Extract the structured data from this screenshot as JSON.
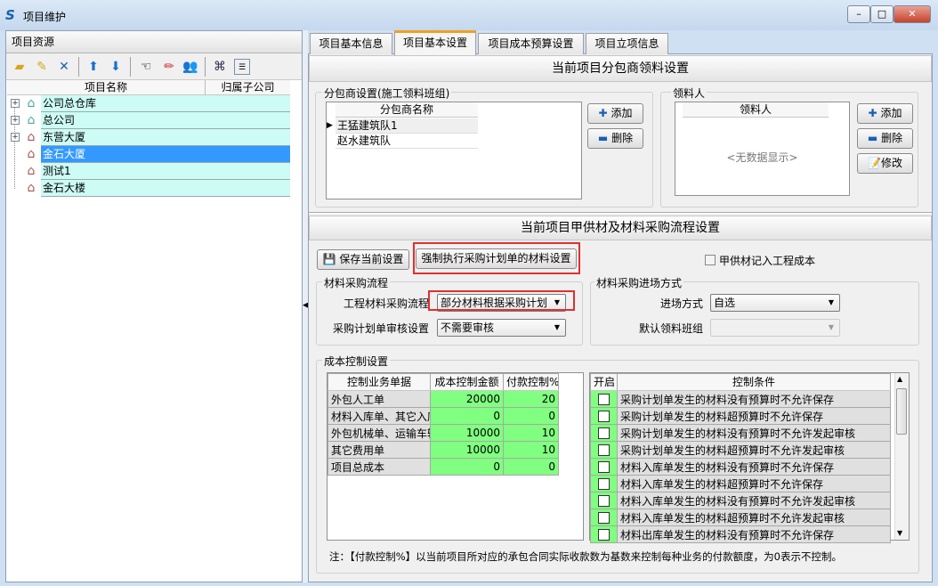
{
  "window": {
    "title": "项目维护",
    "controls": [
      "minimize",
      "maximize",
      "close"
    ]
  },
  "left": {
    "title": "项目资源",
    "toolbar": [
      "new-folder-icon",
      "edit-folder-icon",
      "delete-icon",
      "move-up-icon",
      "move-down-icon",
      "pointer-icon",
      "pencil-icon",
      "users-icon",
      "binoculars-icon",
      "list-icon"
    ],
    "columns": [
      "项目名称",
      "归属子公司"
    ],
    "tree": [
      {
        "label": "公司总仓库",
        "expandable": true,
        "icon": "warehouse-icon"
      },
      {
        "label": "总公司",
        "expandable": true,
        "icon": "warehouse-icon"
      },
      {
        "label": "东营大厦",
        "expandable": true,
        "icon": "house-icon"
      },
      {
        "label": "金石大厦",
        "expandable": false,
        "icon": "house-icon",
        "selected": true
      },
      {
        "label": "测试1",
        "expandable": false,
        "icon": "house-icon"
      },
      {
        "label": "金石大楼",
        "expandable": false,
        "icon": "house-icon"
      }
    ]
  },
  "tabs": [
    {
      "label": "项目基本信息"
    },
    {
      "label": "项目基本设置",
      "active": true
    },
    {
      "label": "项目成本预算设置"
    },
    {
      "label": "项目立项信息"
    }
  ],
  "section1": {
    "title": "当前项目分包商领料设置",
    "sub": {
      "group": "分包商设置(施工领料班组)",
      "column": "分包商名称",
      "rows": [
        "王猛建筑队1",
        "赵水建筑队"
      ],
      "add": "添加",
      "delete": "删除"
    },
    "picker": {
      "group": "领料人",
      "column": "领料人",
      "empty": "<无数据显示>",
      "add": "添加",
      "delete": "删除",
      "edit": "修改"
    }
  },
  "section2": {
    "title": "当前项目甲供材及材料采购流程设置",
    "save": "保存当前设置",
    "force": "强制执行采购计划单的材料设置",
    "checkbox": {
      "label": "甲供材记入工程成本",
      "checked": false
    },
    "flow": {
      "group": "材料采购流程",
      "label1": "工程材料采购流程",
      "value1": "部分材料根据采购计划",
      "label2": "采购计划单审核设置",
      "value2": "不需要审核"
    },
    "entry": {
      "group": "材料采购进场方式",
      "label1": "进场方式",
      "value1": "自选",
      "label2": "默认领料班组",
      "value2": ""
    }
  },
  "cost": {
    "group": "成本控制设置",
    "columns": [
      "控制业务单据",
      "成本控制金额",
      "付款控制%"
    ],
    "rows": [
      [
        "外包人工单",
        "20000",
        "20"
      ],
      [
        "材料入库单、其它入库",
        "0",
        "0"
      ],
      [
        "外包机械单、运输车辆",
        "10000",
        "10"
      ],
      [
        "其它费用单",
        "10000",
        "10"
      ],
      [
        "项目总成本",
        "0",
        "0"
      ]
    ],
    "cond_columns": [
      "开启",
      "控制条件"
    ],
    "conditions": [
      "采购计划单发生的材料没有预算时不允许保存",
      "采购计划单发生的材料超预算时不允许保存",
      "采购计划单发生的材料没有预算时不允许发起审核",
      "采购计划单发生的材料超预算时不允许发起审核",
      "材料入库单发生的材料没有预算时不允许保存",
      "材料入库单发生的材料超预算时不允许保存",
      "材料入库单发生的材料没有预算时不允许发起审核",
      "材料入库单发生的材料超预算时不允许发起审核",
      "材料出库单发生的材料没有预算时不允许保存"
    ],
    "note": "注：【付款控制%】以当前项目所对应的承包合同实际收款数为基数来控制每种业务的付款额度，为0表示不控制。"
  },
  "colors": {
    "tree_row": "#cdfbf5",
    "selected": "#3399ff",
    "grid_green": "#80ff80",
    "highlight": "#e03030"
  }
}
